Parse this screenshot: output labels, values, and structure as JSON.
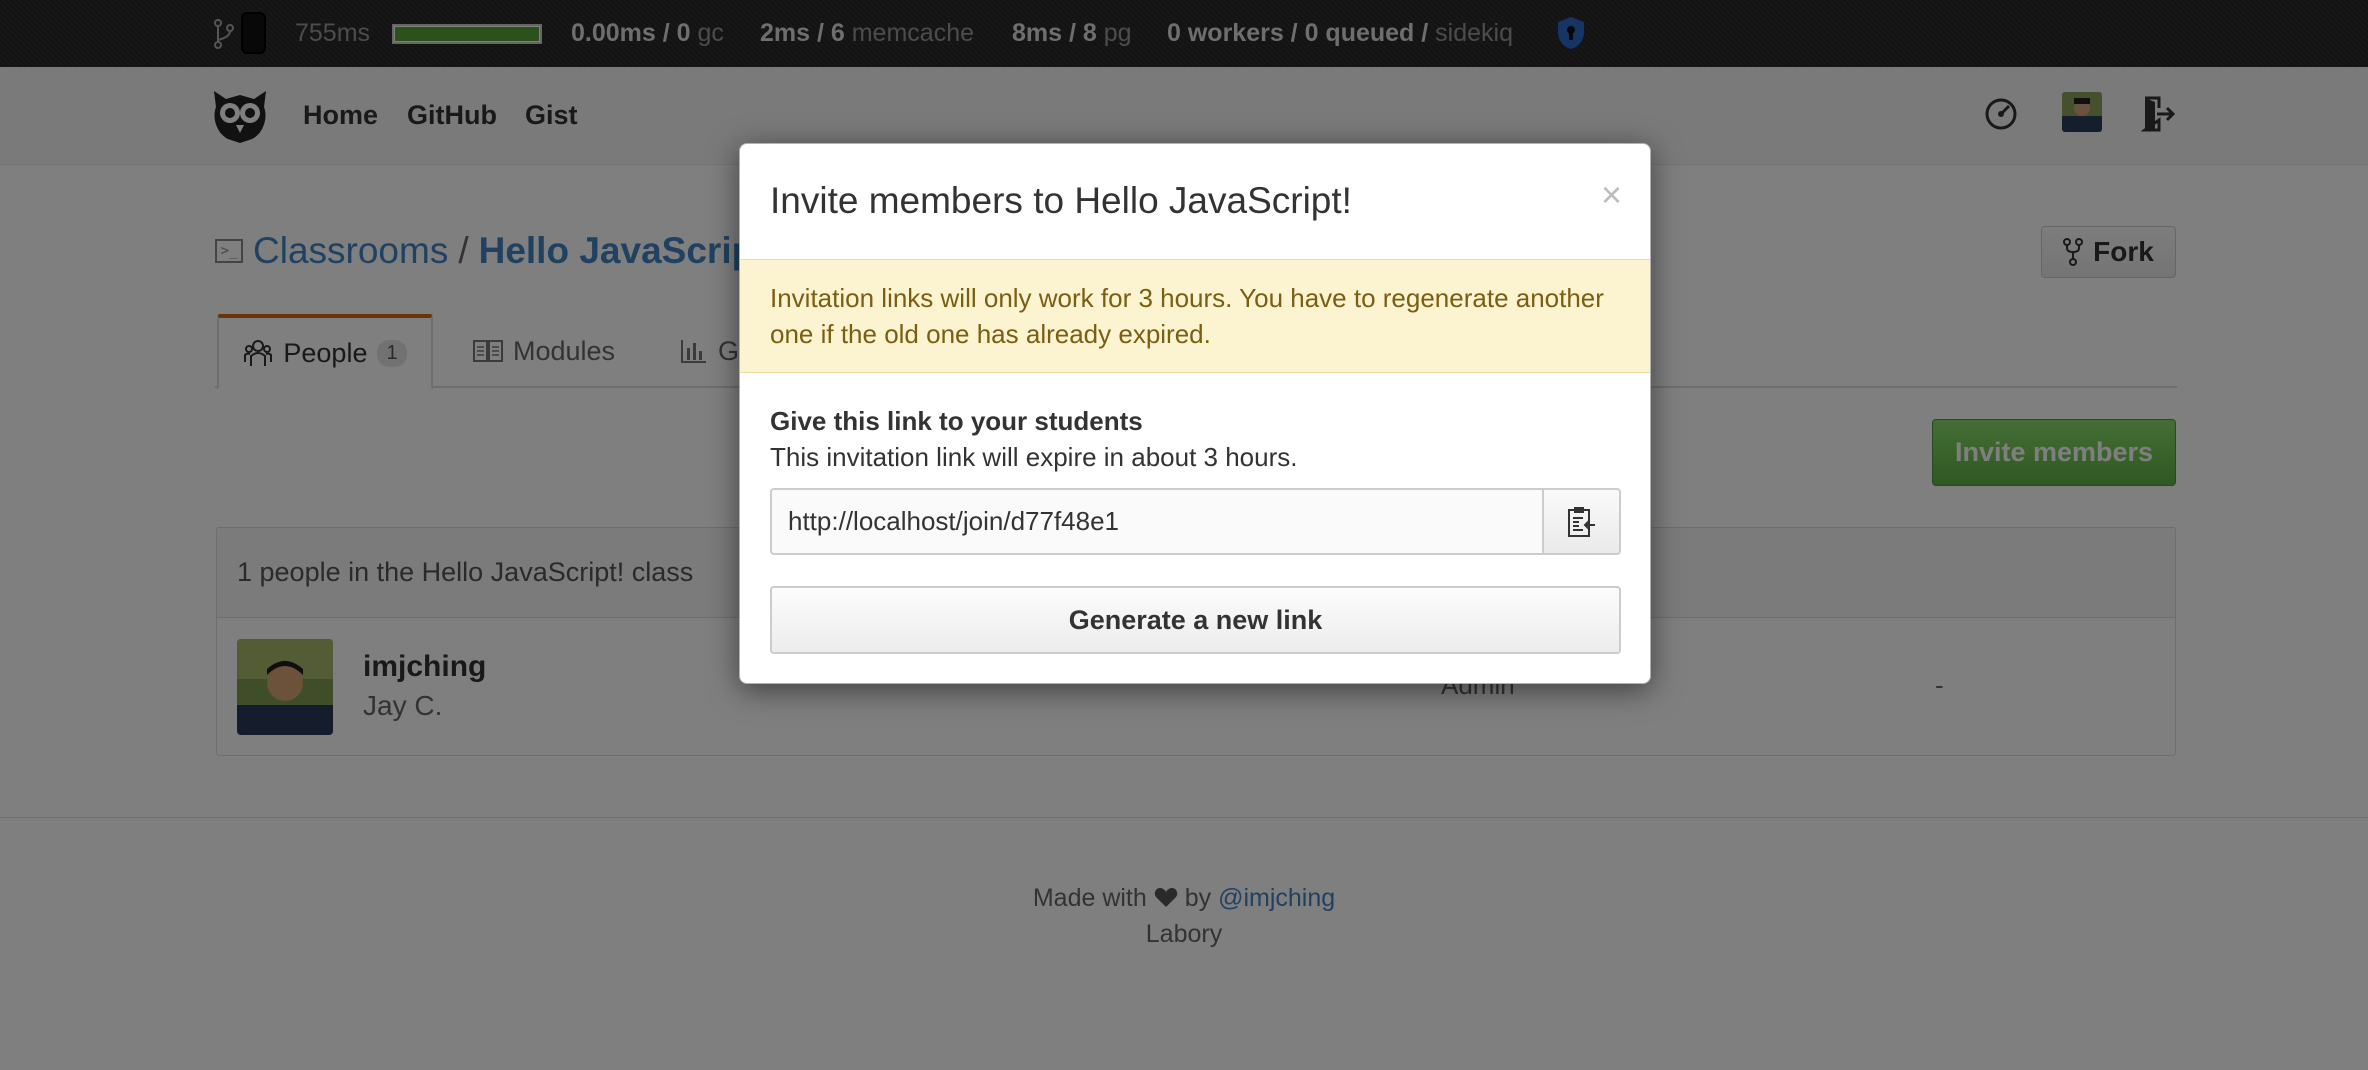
{
  "staffbar": {
    "total_time": "755ms",
    "progress": 1.0,
    "gc_time": "0.00ms / 0",
    "gc_label": "gc",
    "memcache_value": "2ms / 6",
    "memcache_label": "memcache",
    "pg_value": "8ms / 8",
    "pg_label": "pg",
    "sidekiq_value": "0 workers / 0 queued /",
    "sidekiq_label": "sidekiq"
  },
  "nav": {
    "home": "Home",
    "github": "GitHub",
    "gist": "Gist"
  },
  "breadcrumb": {
    "parent": "Classrooms",
    "separator": "/",
    "current": "Hello JavaScript!"
  },
  "fork_label": "Fork",
  "tabs": [
    {
      "label": "People",
      "count": "1"
    },
    {
      "label": "Modules"
    },
    {
      "label": "Grades"
    }
  ],
  "invite_button": "Invite members",
  "people": {
    "summary": "1 people in the Hello JavaScript! class",
    "members": [
      {
        "login": "imjching",
        "name": "Jay C.",
        "role": "Admin",
        "extra": "-"
      }
    ]
  },
  "footer": {
    "made_with": "Made with",
    "by": "by",
    "author": "@imjching",
    "brand": "Labory"
  },
  "modal": {
    "title": "Invite members to Hello JavaScript!",
    "close": "×",
    "warning": "Invitation links will only work for 3 hours. You have to regenerate another one if the old one has already expired.",
    "subtitle": "Give this link to your students",
    "description": "This invitation link will expire in about 3 hours.",
    "link_value": "http://localhost/join/d77f48e1",
    "generate_button": "Generate a new link"
  },
  "colors": {
    "accent": "#4183c4",
    "success": "#60b044",
    "tab_active": "#d26911",
    "warning_bg": "#fcf3d0"
  },
  "icons": [
    "branch-icon",
    "phone-icon",
    "shield-icon",
    "owl-logo",
    "dashboard-icon",
    "logout-icon",
    "terminal-icon",
    "fork-icon",
    "people-icon",
    "modules-icon",
    "grades-icon",
    "clipboard-icon",
    "heart-icon"
  ]
}
